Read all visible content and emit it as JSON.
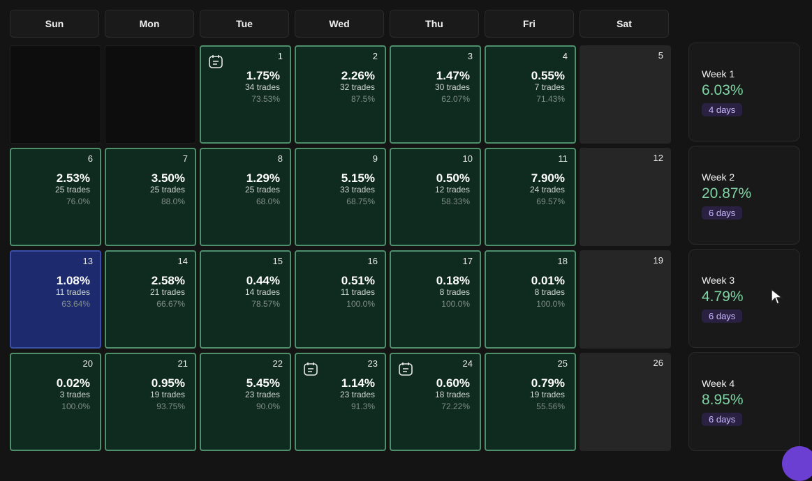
{
  "weekday_headers": [
    "Sun",
    "Mon",
    "Tue",
    "Wed",
    "Thu",
    "Fri",
    "Sat"
  ],
  "rows": [
    [
      {
        "type": "empty"
      },
      {
        "type": "empty"
      },
      {
        "type": "green",
        "day": "1",
        "pct": "1.75%",
        "trades": "34 trades",
        "winrate": "73.53%",
        "note": true
      },
      {
        "type": "green",
        "day": "2",
        "pct": "2.26%",
        "trades": "32 trades",
        "winrate": "87.5%"
      },
      {
        "type": "green",
        "day": "3",
        "pct": "1.47%",
        "trades": "30 trades",
        "winrate": "62.07%"
      },
      {
        "type": "green",
        "day": "4",
        "pct": "0.55%",
        "trades": "7 trades",
        "winrate": "71.43%"
      },
      {
        "type": "sat",
        "day": "5"
      }
    ],
    [
      {
        "type": "green",
        "day": "6",
        "pct": "2.53%",
        "trades": "25 trades",
        "winrate": "76.0%"
      },
      {
        "type": "green",
        "day": "7",
        "pct": "3.50%",
        "trades": "25 trades",
        "winrate": "88.0%"
      },
      {
        "type": "green",
        "day": "8",
        "pct": "1.29%",
        "trades": "25 trades",
        "winrate": "68.0%"
      },
      {
        "type": "green",
        "day": "9",
        "pct": "5.15%",
        "trades": "33 trades",
        "winrate": "68.75%"
      },
      {
        "type": "green",
        "day": "10",
        "pct": "0.50%",
        "trades": "12 trades",
        "winrate": "58.33%"
      },
      {
        "type": "green",
        "day": "11",
        "pct": "7.90%",
        "trades": "24 trades",
        "winrate": "69.57%"
      },
      {
        "type": "sat",
        "day": "12"
      }
    ],
    [
      {
        "type": "selected",
        "day": "13",
        "pct": "1.08%",
        "trades": "11 trades",
        "winrate": "63.64%"
      },
      {
        "type": "green",
        "day": "14",
        "pct": "2.58%",
        "trades": "21 trades",
        "winrate": "66.67%"
      },
      {
        "type": "green",
        "day": "15",
        "pct": "0.44%",
        "trades": "14 trades",
        "winrate": "78.57%"
      },
      {
        "type": "green",
        "day": "16",
        "pct": "0.51%",
        "trades": "11 trades",
        "winrate": "100.0%"
      },
      {
        "type": "green",
        "day": "17",
        "pct": "0.18%",
        "trades": "8 trades",
        "winrate": "100.0%"
      },
      {
        "type": "green",
        "day": "18",
        "pct": "0.01%",
        "trades": "8 trades",
        "winrate": "100.0%"
      },
      {
        "type": "sat",
        "day": "19"
      }
    ],
    [
      {
        "type": "green",
        "day": "20",
        "pct": "0.02%",
        "trades": "3 trades",
        "winrate": "100.0%"
      },
      {
        "type": "green",
        "day": "21",
        "pct": "0.95%",
        "trades": "19 trades",
        "winrate": "93.75%"
      },
      {
        "type": "green",
        "day": "22",
        "pct": "5.45%",
        "trades": "23 trades",
        "winrate": "90.0%"
      },
      {
        "type": "green",
        "day": "23",
        "pct": "1.14%",
        "trades": "23 trades",
        "winrate": "91.3%",
        "note": true
      },
      {
        "type": "green",
        "day": "24",
        "pct": "0.60%",
        "trades": "18 trades",
        "winrate": "72.22%",
        "note": true
      },
      {
        "type": "green",
        "day": "25",
        "pct": "0.79%",
        "trades": "19 trades",
        "winrate": "55.56%"
      },
      {
        "type": "sat",
        "day": "26"
      }
    ]
  ],
  "weeks": [
    {
      "label": "Week 1",
      "pct": "6.03%",
      "days": "4 days"
    },
    {
      "label": "Week 2",
      "pct": "20.87%",
      "days": "6 days"
    },
    {
      "label": "Week 3",
      "pct": "4.79%",
      "days": "6 days"
    },
    {
      "label": "Week 4",
      "pct": "8.95%",
      "days": "6 days"
    }
  ],
  "icons": {
    "note": "note-icon",
    "cursor": "cursor-icon"
  },
  "colors": {
    "accent_green": "#7ed4a4",
    "cell_green": "#0f2a1f",
    "cell_selected": "#1d2a6e",
    "badge_purple": "#cbb8ff"
  }
}
